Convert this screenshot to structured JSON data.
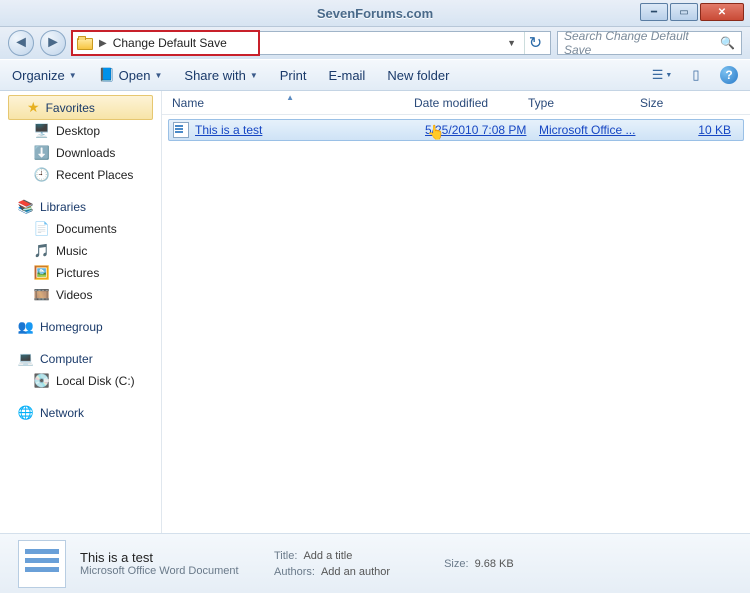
{
  "titlebar": {
    "text": "SevenForums.com"
  },
  "address": {
    "path_label": "Change Default Save"
  },
  "search": {
    "placeholder": "Search Change Default Save"
  },
  "toolbar": {
    "organize": "Organize",
    "open": "Open",
    "share": "Share with",
    "print": "Print",
    "email": "E-mail",
    "newfolder": "New folder"
  },
  "sidebar": {
    "favorites": {
      "label": "Favorites",
      "items": [
        "Desktop",
        "Downloads",
        "Recent Places"
      ]
    },
    "libraries": {
      "label": "Libraries",
      "items": [
        "Documents",
        "Music",
        "Pictures",
        "Videos"
      ]
    },
    "homegroup": {
      "label": "Homegroup"
    },
    "computer": {
      "label": "Computer",
      "items": [
        "Local Disk (C:)"
      ]
    },
    "network": {
      "label": "Network"
    }
  },
  "columns": {
    "name": "Name",
    "date": "Date modified",
    "type": "Type",
    "size": "Size"
  },
  "file": {
    "name": "This is a test",
    "date": "5/25/2010 7:08 PM",
    "type": "Microsoft Office ...",
    "size": "10 KB"
  },
  "details": {
    "title": "This is a test",
    "subtitle": "Microsoft Office Word Document",
    "title_k": "Title:",
    "title_v": "Add a title",
    "authors_k": "Authors:",
    "authors_v": "Add an author",
    "size_k": "Size:",
    "size_v": "9.68 KB"
  }
}
